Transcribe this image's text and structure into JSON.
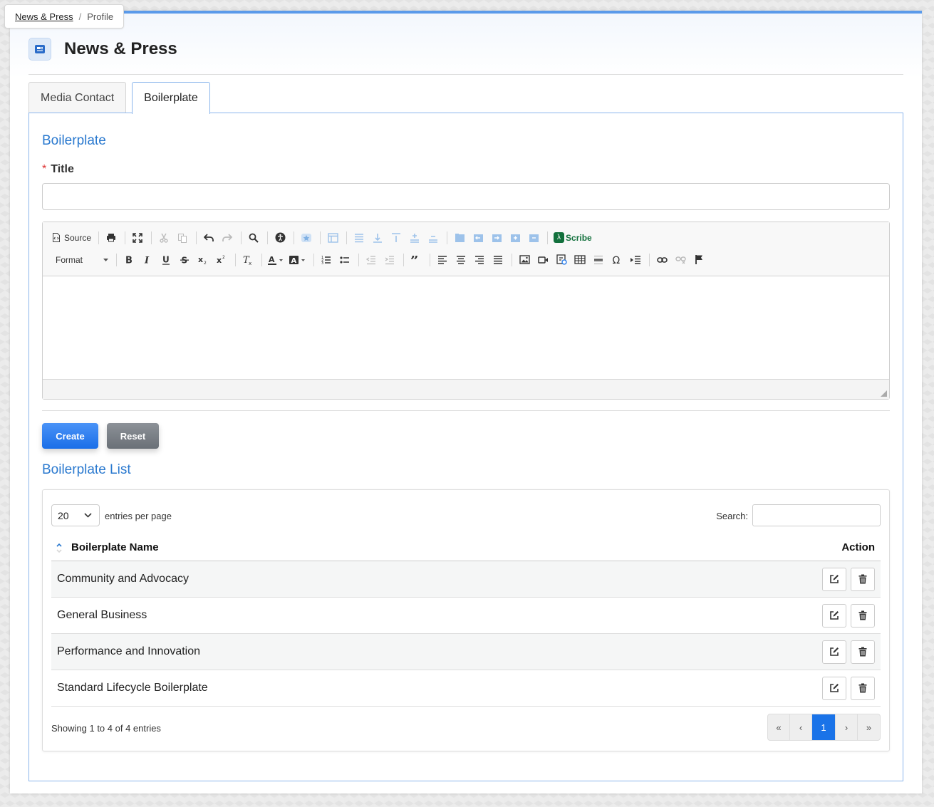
{
  "breadcrumb": {
    "parent": "News & Press",
    "separator": "/",
    "current": "Profile"
  },
  "page": {
    "title": "News & Press",
    "icon": "newspaper-icon"
  },
  "tabs": [
    {
      "label": "Media Contact",
      "active": false
    },
    {
      "label": "Boilerplate",
      "active": true
    }
  ],
  "form": {
    "section_title": "Boilerplate",
    "title_label": "Title",
    "required_marker": "*",
    "title_value": ""
  },
  "editor": {
    "source_label": "Source",
    "scribe_label": "Scribe",
    "format_label": "Format",
    "content": ""
  },
  "buttons": {
    "create": "Create",
    "reset": "Reset"
  },
  "list": {
    "section_title": "Boilerplate List",
    "per_page_value": "20",
    "per_page_text": "entries per page",
    "search_label": "Search:",
    "search_value": "",
    "columns": [
      "Boilerplate Name",
      "Action"
    ],
    "rows": [
      {
        "name": "Community and Advocacy"
      },
      {
        "name": "General Business"
      },
      {
        "name": "Performance and Innovation"
      },
      {
        "name": "Standard Lifecycle Boilerplate"
      }
    ],
    "info": "Showing 1 to 4 of 4 entries",
    "pagination": {
      "first": "«",
      "prev": "‹",
      "current": "1",
      "next": "›",
      "last": "»"
    }
  },
  "colors": {
    "accent": "#2a79cf",
    "primary": "#1a73e8",
    "secondary": "#6a7077",
    "border_blue": "#8bb6ec"
  }
}
